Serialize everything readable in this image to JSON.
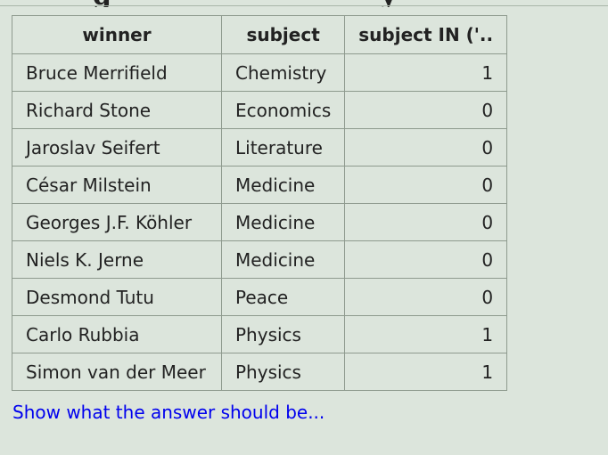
{
  "table": {
    "headers": [
      "winner",
      "subject",
      "subject IN ('.."
    ],
    "rows": [
      [
        "Bruce Merrifield",
        "Chemistry",
        "1"
      ],
      [
        "Richard Stone",
        "Economics",
        "0"
      ],
      [
        "Jaroslav Seifert",
        "Literature",
        "0"
      ],
      [
        "César Milstein",
        "Medicine",
        "0"
      ],
      [
        "Georges J.F. Köhler",
        "Medicine",
        "0"
      ],
      [
        "Niels K. Jerne",
        "Medicine",
        "0"
      ],
      [
        "Desmond Tutu",
        "Peace",
        "0"
      ],
      [
        "Carlo Rubbia",
        "Physics",
        "1"
      ],
      [
        "Simon van der Meer",
        "Physics",
        "1"
      ]
    ]
  },
  "answer_link": {
    "label": "Show what the answer should be..."
  },
  "colors": {
    "background": "#dce5dc",
    "border": "#8e9a8e",
    "link": "#0000ee"
  }
}
